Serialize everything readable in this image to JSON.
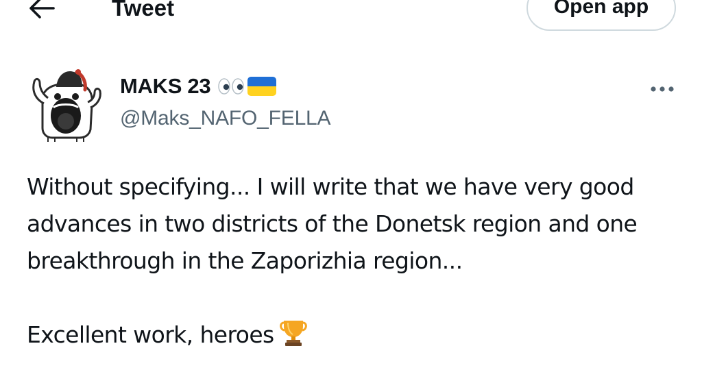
{
  "header": {
    "title": "Tweet",
    "open_app_label": "Open app",
    "back_icon": "arrow-left-icon"
  },
  "author": {
    "display_name": "MAKS 23",
    "handle": "@Maks_NAFO_FELLA",
    "emoji": [
      "eyes-icon",
      "ukraine-flag-icon"
    ],
    "flag_colors": {
      "top": "#1f6fd6",
      "bottom": "#ffd21f"
    },
    "avatar_icon": "nafo-fella-avatar-icon"
  },
  "tweet": {
    "paragraph_1": "Without specifying... I will write that we have very good advances in two districts of the Donetsk region and one breakthrough in the Zaporizhia region...",
    "paragraph_2": "Excellent work, heroes",
    "trailing_icon": "trophy-icon"
  },
  "colors": {
    "text_primary": "#0f1419",
    "text_secondary": "#536471",
    "border": "#cfd9de"
  }
}
